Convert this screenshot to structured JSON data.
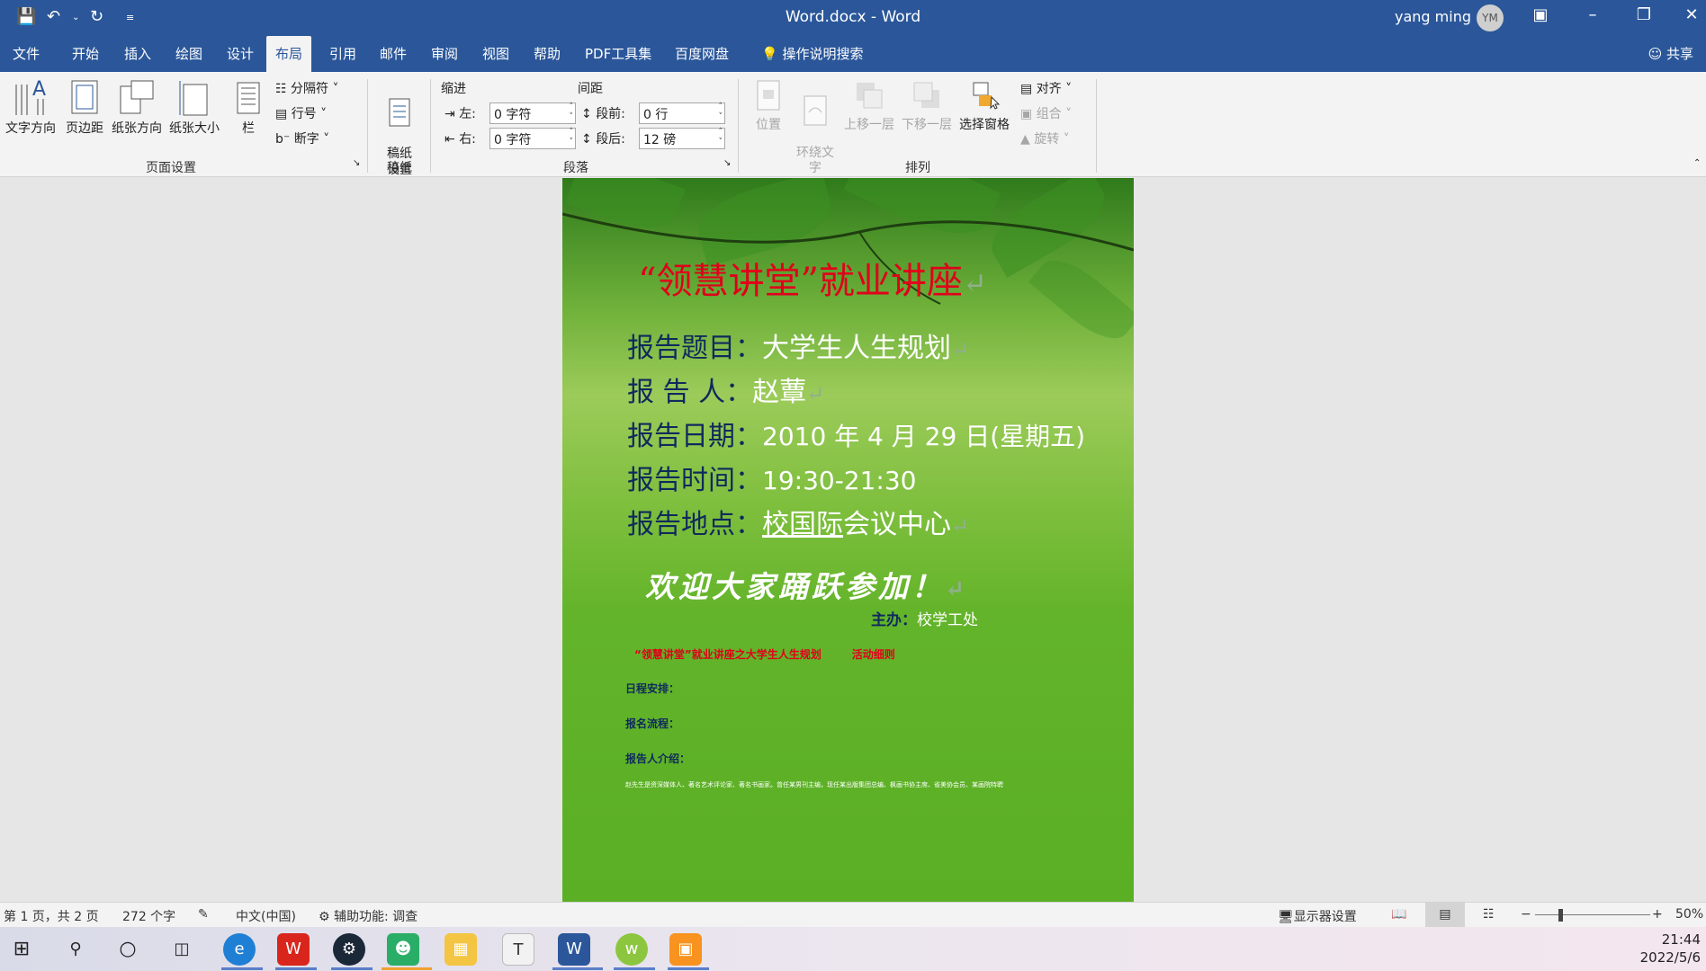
{
  "window": {
    "doc_title": "Word.docx  -  Word",
    "user_name": "yang ming",
    "avatar_initials": "YM"
  },
  "menu": {
    "tabs": [
      "文件",
      "开始",
      "插入",
      "绘图",
      "设计",
      "布局",
      "引用",
      "邮件",
      "审阅",
      "视图",
      "帮助",
      "PDF工具集",
      "百度网盘",
      "操作说明搜索"
    ],
    "active_tab": "布局",
    "share": "共享"
  },
  "ribbon": {
    "page_setup": {
      "text_direction": "文字方向",
      "margins": "页边距",
      "orientation": "纸张方向",
      "size": "纸张大小",
      "columns": "栏",
      "breaks": "分隔符",
      "line_numbers": "行号",
      "hyphenation": "断字",
      "group_label": "页面设置"
    },
    "manuscript": {
      "button": "稿纸\n设置",
      "group_label": "稿纸"
    },
    "paragraph": {
      "indent_label": "缩进",
      "spacing_label": "间距",
      "left_label": "左:",
      "right_label": "右:",
      "before_label": "段前:",
      "after_label": "段后:",
      "left_value": "0 字符",
      "right_value": "0 字符",
      "before_value": "0 行",
      "after_value": "12 磅",
      "group_label": "段落"
    },
    "arrange": {
      "position": "位置",
      "wrap_text": "环绕文\n字",
      "bring_forward": "上移一层",
      "send_backward": "下移一层",
      "selection_pane": "选择窗格",
      "align": "对齐",
      "group": "组合",
      "rotate": "旋转",
      "group_label": "排列"
    }
  },
  "document": {
    "title_quote": "“领慧讲堂”就业讲座",
    "rows": [
      {
        "label": "报告题目：",
        "value": "大学生人生规划"
      },
      {
        "label": "报 告 人：",
        "value": "赵蕈"
      },
      {
        "label": "报告日期：",
        "value": "2010 年 4 月 29 日(星期五)"
      },
      {
        "label": "报告时间：",
        "value": "19:30-21:30"
      },
      {
        "label": "报告地点：",
        "value_underlined": "校国际",
        "value_rest": "会议中心"
      }
    ],
    "welcome": "欢迎大家踊跃参加！",
    "host_label": "主办：",
    "host_value": "校学工处",
    "subtitle_red": "“领慧讲堂”就业讲座之大学生人生规划",
    "subtitle_red2": "活动细则",
    "schedule": "日程安排：",
    "signup": "报名流程：",
    "speaker_intro": "报告人介绍：",
    "bio": "赵先生是资深媒体人、著名艺术评论家、著名书画家。曾任某男刊主编，现任某出版集团总编、枫画书协主席、省美协会员、某画院特聘"
  },
  "status": {
    "page": "第 1 页，共 2 页",
    "words": "272 个字",
    "language": "中文(中国)",
    "accessibility": "辅助功能: 调查",
    "display_settings": "显示器设置",
    "zoom": "50%"
  },
  "taskbar": {
    "time": "21:44",
    "date": "2022/5/6"
  },
  "colors": {
    "word_blue": "#2b579a",
    "title_red": "#e0001a",
    "label_navy": "#0f2a5c"
  }
}
